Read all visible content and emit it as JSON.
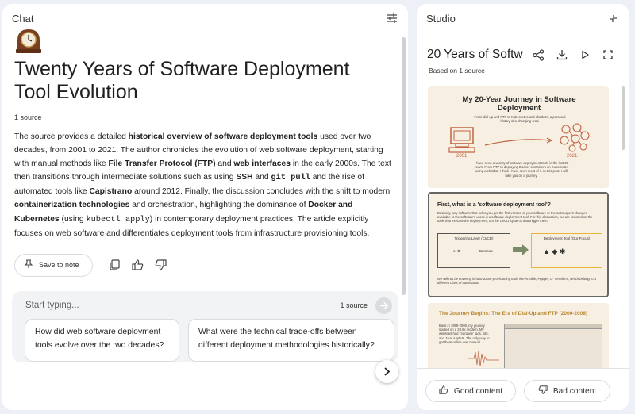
{
  "chat": {
    "header_title": "Chat",
    "heading": "Twenty Years of Software Deployment Tool Evolution",
    "source_count": "1 source",
    "summary": {
      "p1": "The source provides a detailed ",
      "b1": "historical overview of software deployment tools",
      "p2": " used over two decades, from 2001 to 2021. The author chronicles the evolution of web software deployment, starting with manual methods like ",
      "b2": "File Transfer Protocol (FTP)",
      "p3": " and ",
      "b3": "web interfaces",
      "p4": " in the early 2000s. The text then transitions through intermediate solutions such as using ",
      "b4": "SSH",
      "p5": " and ",
      "c1": "git pull",
      "p6": " and the rise of automated tools like ",
      "b5": "Capistrano",
      "p7": " around 2012. Finally, the discussion concludes with the shift to modern ",
      "b6": "containerization technologies",
      "p8": " and orchestration, highlighting the dominance of ",
      "b7": "Docker and Kubernetes",
      "p9": " (using ",
      "c2": "kubectl apply",
      "p10": ") in contemporary deployment practices. The article explicitly focuses on web software and differentiates deployment tools from infrastructure provisioning tools."
    },
    "save_to_note": "Save to note",
    "input_placeholder": "Start typing...",
    "input_source_count": "1 source",
    "suggestions": [
      "How did web software deployment tools evolve over the two decades?",
      "What were the technical trade-offs between different deployment methodologies historically?"
    ]
  },
  "studio": {
    "header_title": "Studio",
    "title": "20 Years of Softw",
    "based_on": "Based on 1 source",
    "slide1": {
      "title": "My 20-Year Journey in Software Deployment",
      "subtitle": "From dial-up and FTP to Kubernetes and chatbots, a personal history of a changing craft.",
      "year_left": "2001",
      "year_right": "2021+",
      "body": "I have seen a variety of software deployment tools in the last 20 years. From FTP to deploying Docker containers on Kubernetes using a chatbot, I think I have seen most of it. In this post, I will take you on a journey."
    },
    "slide2": {
      "title": "First, what is a 'software deployment tool'?",
      "body": "Basically, any software that helps you get the first version of your software or the subsequent changes available to the software's users is a software deployment tool. For this discussion, we are focused on the tools that execute the deployment, not the CI/CD systems that trigger them.",
      "box_left_label": "Triggering Layer (CI/CD)",
      "box_right_label": "Deployment Tool (Our Focus)",
      "bamboo": "Bamboo",
      "footer": "We will not be covering infrastructure provisioning tools like Ansible, Puppet, or Terraform, which belong to a different class of automation."
    },
    "slide3": {
      "title": "The Journey Begins: The Era of Dial-Up and FTP (2000-2006)",
      "body": "Back in 1999-2000, my journey started on a 33.6k modem. My websites had 'marquee' tags, gifs, and Java Applets. The only way to get them online was manual."
    },
    "good_content": "Good content",
    "bad_content": "Bad content"
  },
  "colors": {
    "background": "#eef0f8",
    "slide_bg": "#f7efe2",
    "slide_accent": "#c0623f",
    "slide3_title": "#b8862e"
  }
}
